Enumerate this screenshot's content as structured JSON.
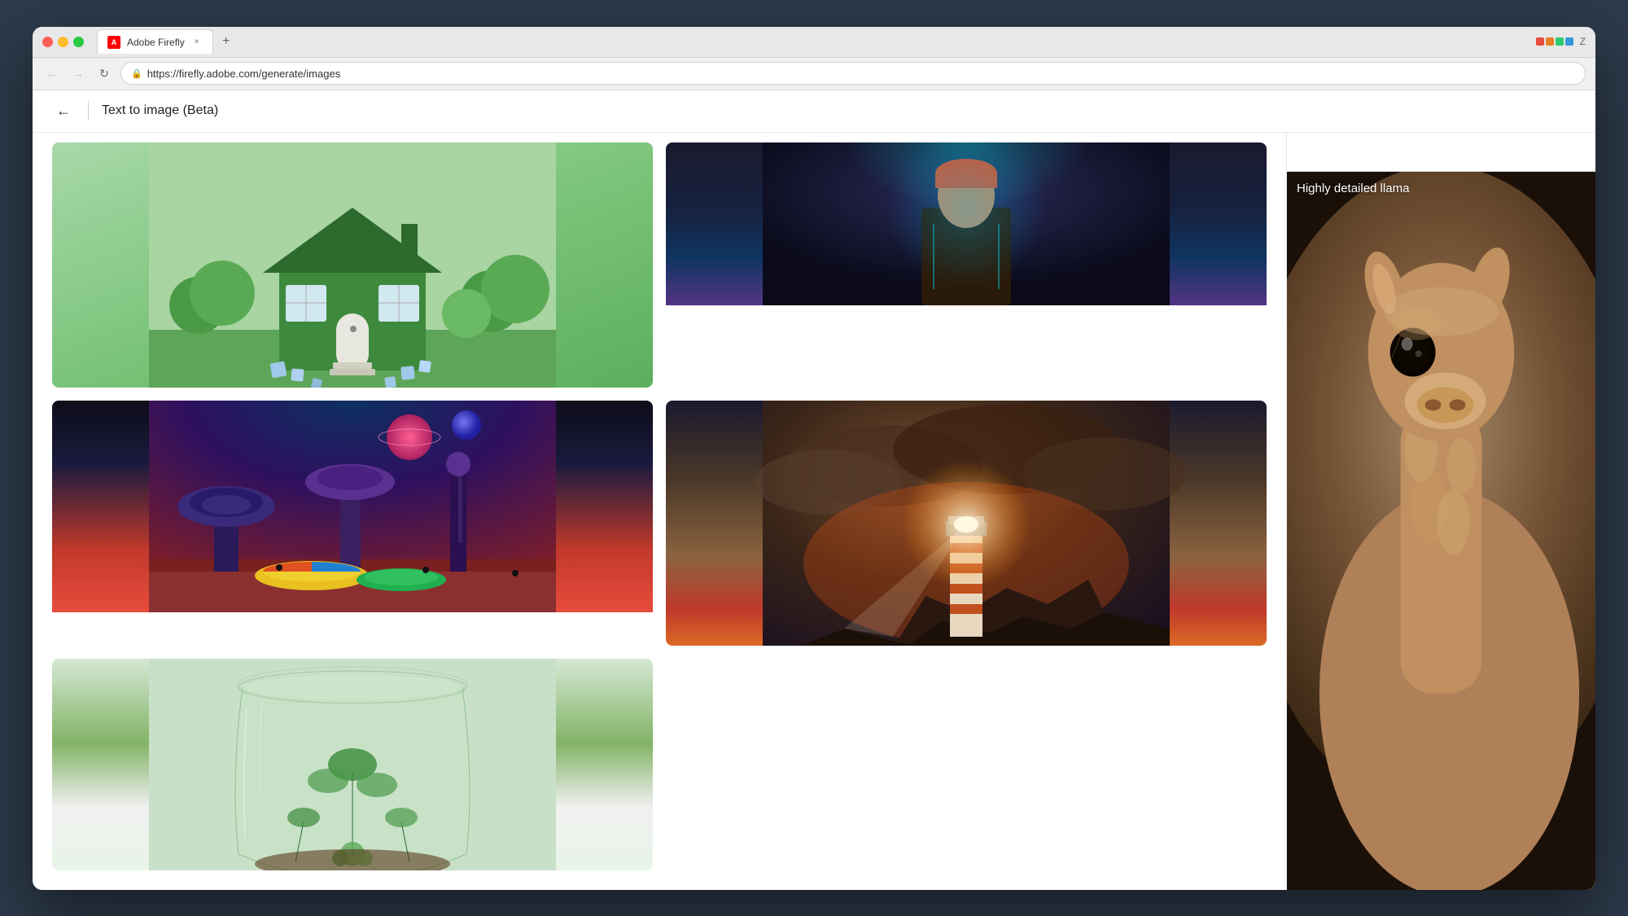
{
  "window": {
    "title": "Adobe Firefly",
    "url": "https://firefly.adobe.com/generate/images",
    "tab_label": "Adobe Firefly"
  },
  "browser": {
    "back_label": "←",
    "forward_label": "→",
    "refresh_label": "↻",
    "new_tab_label": "+",
    "tab_close_label": "×"
  },
  "page": {
    "title": "Text to image (Beta)",
    "back_label": "←"
  },
  "gallery": {
    "images": [
      {
        "id": "house",
        "label": "",
        "type": "house"
      },
      {
        "id": "scifi-person",
        "label": "",
        "type": "scifi_person"
      },
      {
        "id": "alien-city",
        "label": "",
        "type": "alien_city"
      },
      {
        "id": "lighthouse",
        "label": "",
        "type": "lighthouse"
      },
      {
        "id": "terrarium",
        "label": "",
        "type": "terrarium"
      }
    ],
    "side_image": {
      "label": "Highly detailed llama",
      "type": "llama"
    }
  },
  "colors": {
    "accent": "#ff0000",
    "tab_bg": "#ffffff",
    "page_bg": "#ffffff",
    "header_bg": "#e8e8e8"
  }
}
